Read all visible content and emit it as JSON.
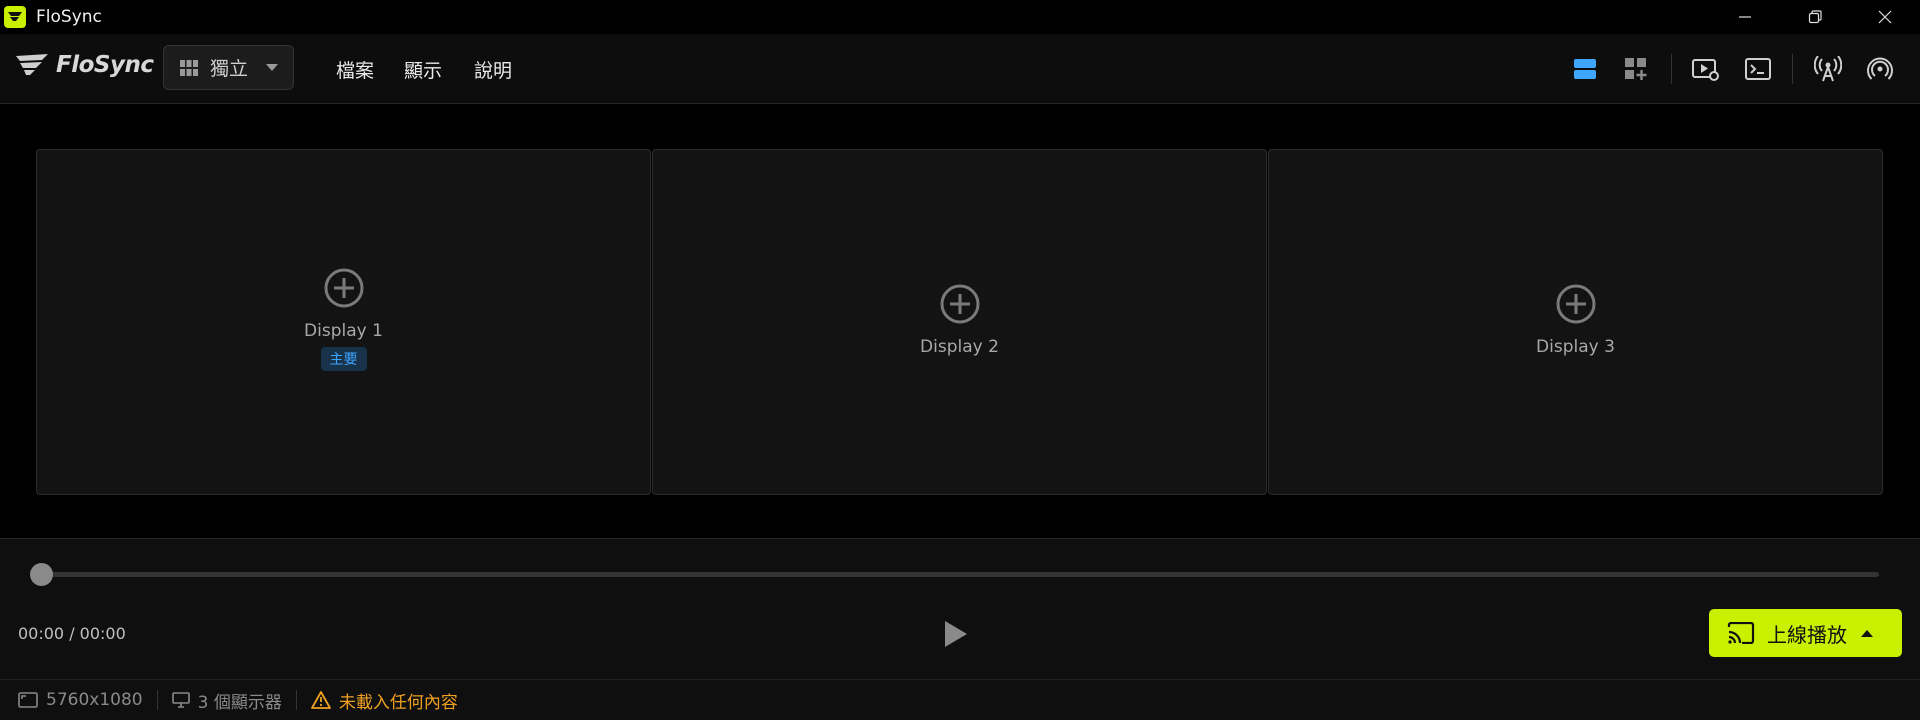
{
  "window": {
    "title": "FloSync",
    "controls": [
      "minimize-icon",
      "restore-icon",
      "close-icon"
    ]
  },
  "brand": {
    "name": "FloSync"
  },
  "mode_dropdown": {
    "label": "獨立",
    "icon": "grid-icon"
  },
  "menu": {
    "items": [
      "檔案",
      "顯示",
      "說明"
    ]
  },
  "toolbar": {
    "buttons": [
      {
        "icon": "layout-rows-icon",
        "active": true
      },
      {
        "icon": "add-layout-icon",
        "active": false
      },
      {
        "icon": "play-settings-icon",
        "active": false
      },
      {
        "icon": "terminal-icon",
        "active": false
      },
      {
        "icon": "broadcast-antenna-icon",
        "active": false
      },
      {
        "icon": "signal-icon",
        "active": false
      }
    ]
  },
  "displays": [
    {
      "label": "Display 1",
      "badge": "主要"
    },
    {
      "label": "Display 2"
    },
    {
      "label": "Display 3"
    }
  ],
  "player": {
    "time": "00:00 / 00:00",
    "progress": 0,
    "cast_button": {
      "label": "上線播放"
    }
  },
  "status": {
    "resolution": "5760x1080",
    "display_count": "3 個顯示器",
    "warning": "未載入任何內容"
  },
  "colors": {
    "accent": "#c8f000",
    "primary_blue": "#3ea6ff",
    "warning": "#f0a020"
  }
}
